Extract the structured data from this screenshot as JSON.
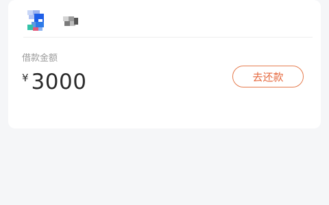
{
  "loan": {
    "amount_label": "借款金额",
    "currency_symbol": "¥",
    "amount": "3000",
    "repay_button_label": "去还款"
  },
  "app": {
    "icon": "app-logo-icon"
  },
  "colors": {
    "accent": "#e5673c",
    "background": "#f5f6f8",
    "card": "#ffffff"
  }
}
